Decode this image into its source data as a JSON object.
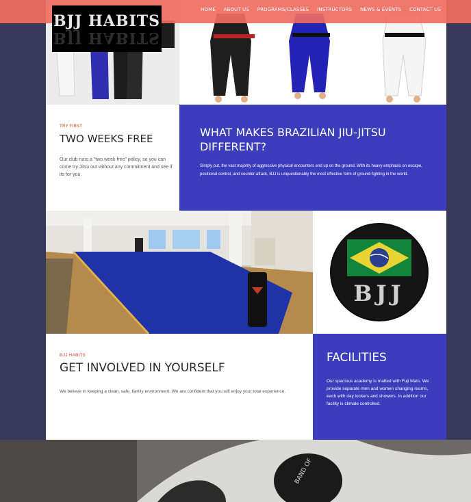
{
  "logo": {
    "text": "BJJ HABITS"
  },
  "nav": {
    "items": [
      {
        "label": "HOME"
      },
      {
        "label": "ABOUT US"
      },
      {
        "label": "PROGRAMS/CLASSES"
      },
      {
        "label": "INSTRUCTORS"
      },
      {
        "label": "NEWS & EVENTS"
      },
      {
        "label": "CONTACT US"
      }
    ]
  },
  "try_first": {
    "kicker": "TRY FIRST",
    "title": "TWO WEEKS FREE",
    "body": "Our club runs a \"two week free\" policy, so you can come try Jitsu out without any commitment and see if its for you."
  },
  "bjj_info": {
    "title": "WHAT MAKES BRAZILIAN JIU-JITSU DIFFERENT?",
    "body": "Simply put, the vast majority of aggressive physical encounters end up on the ground. With its heavy emphasis on escape, positional control, and counter-attack, BJJ is unquestionably the most effective form of ground-fighting in the world."
  },
  "badge": {
    "text": "BJJ"
  },
  "involved": {
    "kicker": "BJJ HABITS",
    "title": "GET INVOLVED IN YOURSELF",
    "body": "We believe in keeping a clean, safe, family environment. We are confident that you will enjoy your total experience."
  },
  "facilities": {
    "title": "FACILITIES",
    "body": "Our spacious academy is matted with Fuji Mats. We provide separate men and women changing rooms, each with day lockers and showers. In addition our facility is climate controlled."
  },
  "bottom_image": {
    "patch_text": "BAND OF"
  },
  "colors": {
    "accent": "#ef6c60",
    "blue": "#3b3dbc",
    "background": "#38385c"
  }
}
